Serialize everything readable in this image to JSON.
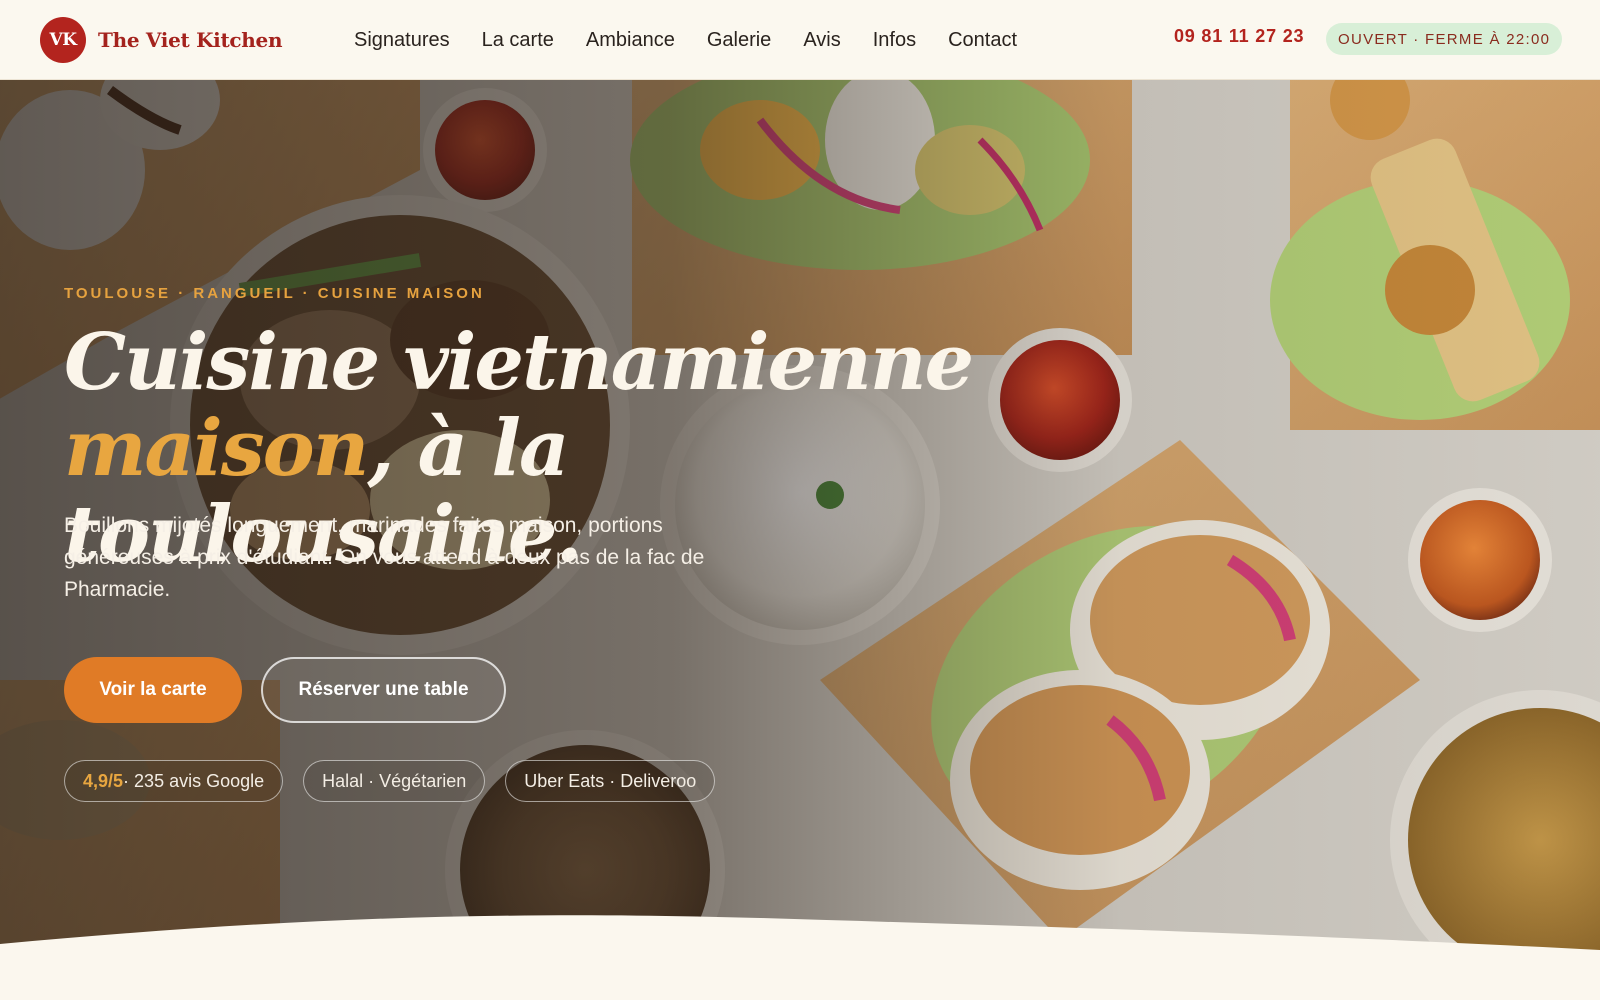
{
  "header": {
    "logo_initials": "VK",
    "brand_name": "The Viet Kitchen",
    "nav": [
      {
        "label": "Signatures"
      },
      {
        "label": "La carte"
      },
      {
        "label": "Ambiance"
      },
      {
        "label": "Galerie"
      },
      {
        "label": "Avis"
      },
      {
        "label": "Infos"
      },
      {
        "label": "Contact"
      }
    ],
    "phone": "09 81 11 27 23",
    "status": "Ouvert · Ferme à 22:00"
  },
  "hero": {
    "eyebrow": "Toulouse · Rangueil · Cuisine maison",
    "headline_line1": "Cuisine vietnamienne",
    "headline_accent": "maison",
    "headline_rest": ", à la toulousaine.",
    "lead": "Bouillons mijotés longuement, marinades faites maison, portions généreuses à prix d'étudiant. On vous attend à deux pas de la fac de Pharmacie.",
    "primary_cta": "Voir la carte",
    "secondary_cta": "Réserver une table",
    "chips": {
      "rating": "4,9/5",
      "reviews": " · 235 avis Google",
      "diet": "Halal · Végétarien",
      "delivery": "Uber Eats · Deliveroo"
    }
  },
  "colors": {
    "brand_red": "#b3241e",
    "accent_orange": "#e07b26",
    "accent_gold": "#e8a640",
    "cream": "#fbf7ee",
    "open_badge_bg": "#d8efd7"
  }
}
